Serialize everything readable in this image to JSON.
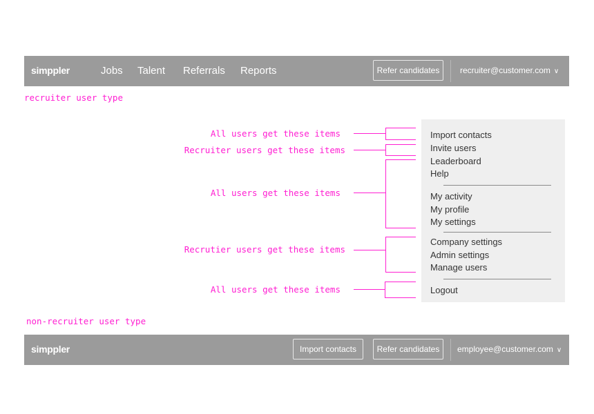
{
  "top_nav": {
    "logo": "simppler",
    "items": [
      "Jobs",
      "Talent",
      "Referrals",
      "Reports"
    ],
    "refer_button": "Refer candidates",
    "account": "recruiter@customer.com"
  },
  "labels": {
    "recruiter": "recruiter user type",
    "non_recruiter": "non-recruiter user type"
  },
  "annotations": [
    "All users get these items",
    "Recruiter users get these items",
    "All users get these items",
    "Recrutier users get these items",
    "All users get these items"
  ],
  "dropdown": {
    "items": [
      "Import contacts",
      "Invite users",
      "Leaderboard",
      "Help",
      "My activity",
      "My profile",
      "My settings",
      "Company settings",
      "Admin settings",
      "Manage users",
      "Logout"
    ]
  },
  "bottom_nav": {
    "logo": "simppler",
    "import_button": "Import contacts",
    "refer_button": "Refer candidates",
    "account": "employee@customer.com"
  },
  "colors": {
    "navbar": "#9b9b9b",
    "annotation": "#ff1fd2",
    "dropdown_bg": "#efefef"
  },
  "icons": {
    "account_menu": "chevron-down-icon"
  }
}
